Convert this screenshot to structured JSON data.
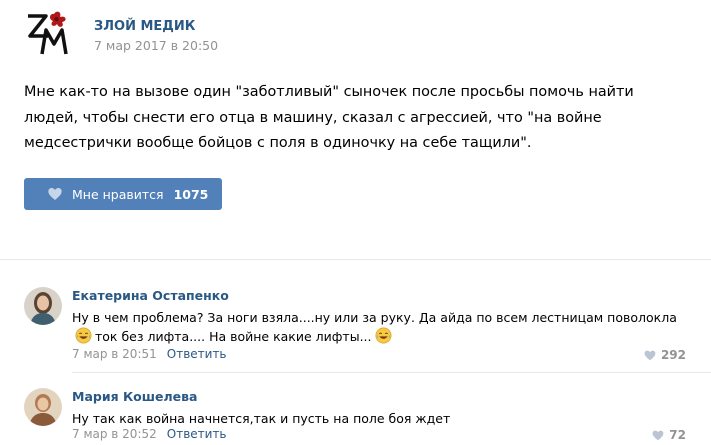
{
  "post": {
    "author": "ЗЛОЙ МЕДИК",
    "date": "7 мар 2017 в 20:50",
    "text": "Мне как-то на вызове один \"заботливый\" сыночек после просьбы помочь найти людей, чтобы снести его отца в машину, сказал с агрессией, что \"на войне медсестрички вообще бойцов с поля в одиночку на себе тащили\".",
    "like_label": "Мне нравится",
    "like_count": "1075"
  },
  "comments": [
    {
      "author": "Екатерина Остапенко",
      "text_part1": "Ну в чем проблема? За ноги взяла....ну или за руку. Да айда по всем лестницам поволокла",
      "text_part2": "ток без лифта.... На войне какие лифты...",
      "date": "7 мар в 20:51",
      "reply_label": "Ответить",
      "likes": "292"
    },
    {
      "author": "Мария Кошелева",
      "text": "Ну так как война начнется,так и пусть на поле боя ждет",
      "date": "7 мар в 20:52",
      "reply_label": "Ответить",
      "likes": "72"
    }
  ],
  "colors": {
    "link": "#2a5885",
    "button": "#5181b8",
    "muted": "#939393",
    "divider": "#e7e8ec"
  },
  "icons": [
    "heart-icon",
    "laughing-emoji-icon"
  ]
}
